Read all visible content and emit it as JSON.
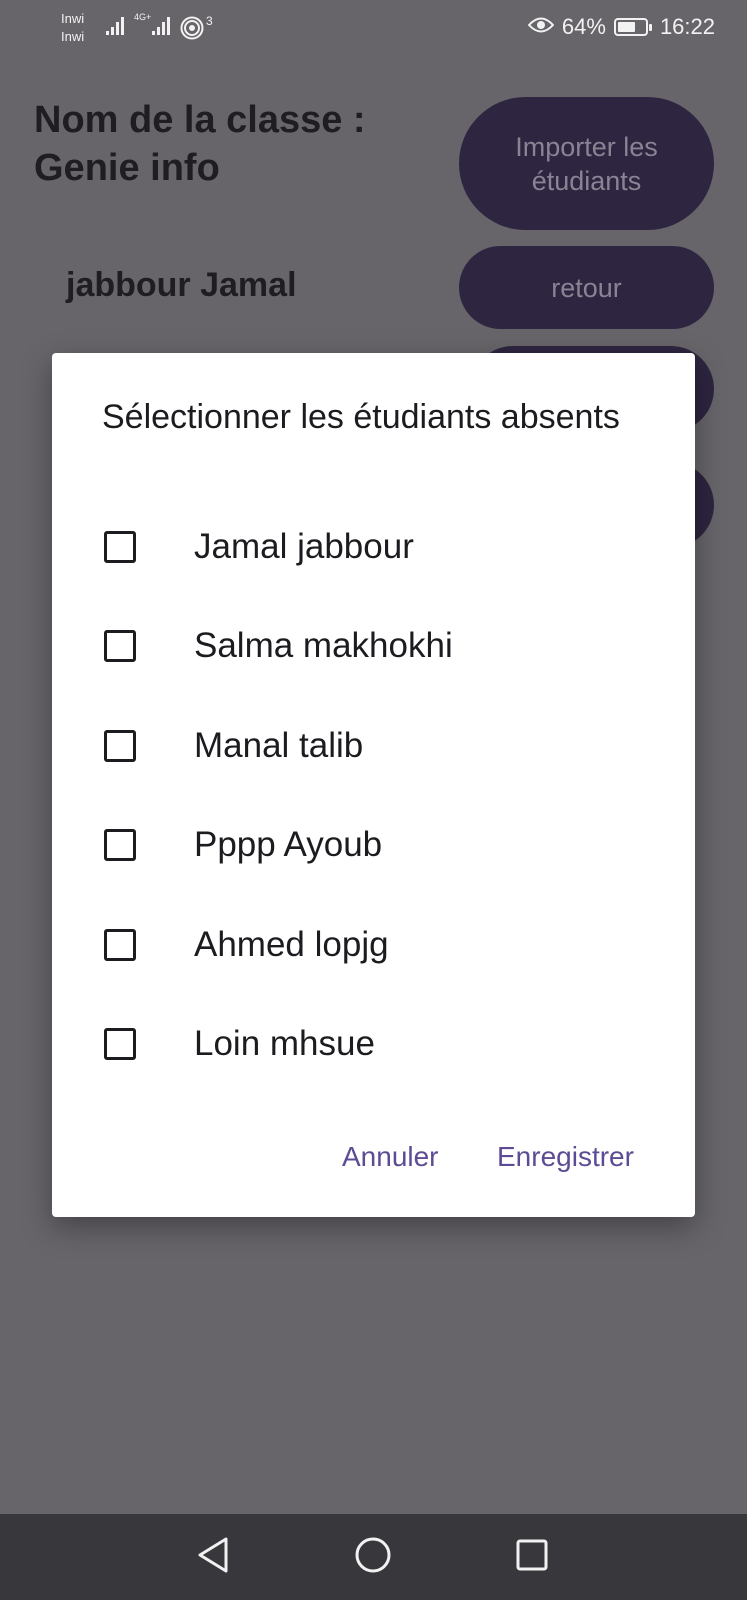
{
  "status_bar": {
    "carrier_1": "Inwi",
    "carrier_2": "Inwi",
    "network_type": "4G+",
    "hotspot_count": "3",
    "battery": "64%",
    "battery_level": 0.64,
    "time": "16:22"
  },
  "background": {
    "class_title": "Nom de la classe : Genie info",
    "student_name": "jabbour Jamal",
    "import_button": "Importer les étudiants",
    "back_button": "retour"
  },
  "dialog": {
    "title": "Sélectionner les étudiants absents",
    "options": [
      {
        "label": "Jamal jabbour",
        "checked": false
      },
      {
        "label": "Salma makhokhi",
        "checked": false
      },
      {
        "label": "Manal talib",
        "checked": false
      },
      {
        "label": "Pppp Ayoub",
        "checked": false
      },
      {
        "label": "Ahmed lopjg",
        "checked": false
      },
      {
        "label": "Loin mhsue",
        "checked": false
      }
    ],
    "cancel_label": "Annuler",
    "save_label": "Enregistrer"
  },
  "nav": {
    "back_icon": "triangle-back-icon",
    "home_icon": "circle-home-icon",
    "recents_icon": "square-recents-icon"
  },
  "colors": {
    "scrim_background": "#67656a",
    "button_purple": "#2e2540",
    "accent_text": "#5d4b94",
    "nav_bar": "#38373b"
  }
}
